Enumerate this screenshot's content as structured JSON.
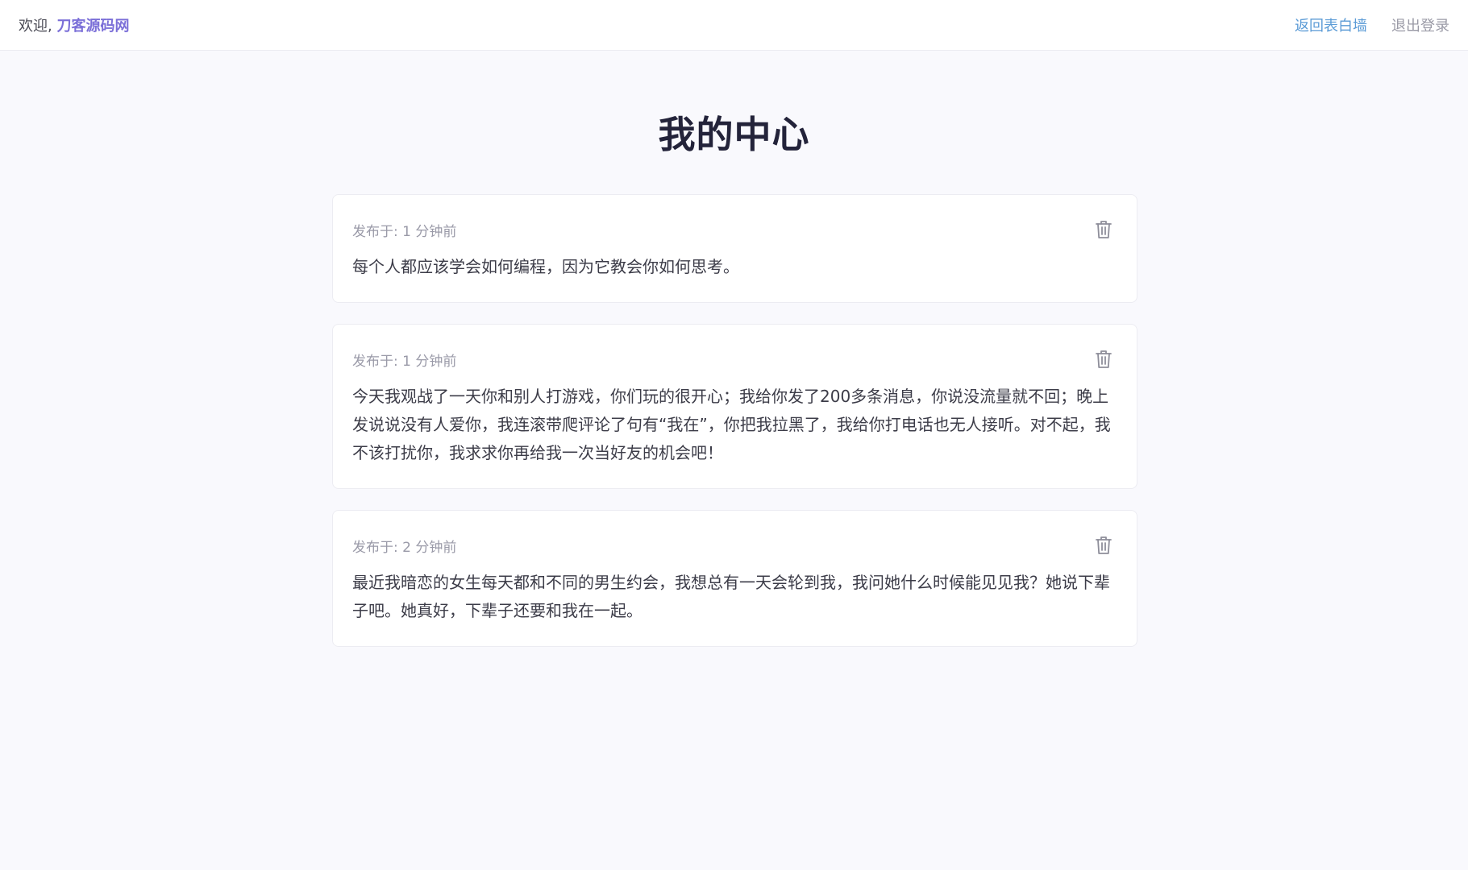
{
  "header": {
    "welcome_prefix": "欢迎, ",
    "username": "刀客源码网",
    "back_label": "返回表白墙",
    "logout_label": "退出登录"
  },
  "page": {
    "title": "我的中心"
  },
  "posts": [
    {
      "meta": "发布于: 1 分钟前",
      "text": "每个人都应该学会如何编程，因为它教会你如何思考。",
      "delete_icon": "trash-icon"
    },
    {
      "meta": "发布于: 1 分钟前",
      "text": "今天我观战了一天你和别人打游戏，你们玩的很开心；我给你发了200多条消息，你说没流量就不回；晚上发说说没有人爱你，我连滚带爬评论了句有“我在”，你把我拉黑了，我给你打电话也无人接听。对不起，我不该打扰你，我求求你再给我一次当好友的机会吧！",
      "delete_icon": "trash-icon"
    },
    {
      "meta": "发布于: 2 分钟前",
      "text": "最近我暗恋的女生每天都和不同的男生约会，我想总有一天会轮到我，我问她什么时候能见见我？她说下辈子吧。她真好，下辈子还要和我在一起。",
      "delete_icon": "trash-icon"
    }
  ],
  "colors": {
    "username": "#7b6fd8",
    "back_link": "#5b9bd6",
    "logout_link": "#9a9aa6",
    "background": "#f9f9fd"
  }
}
